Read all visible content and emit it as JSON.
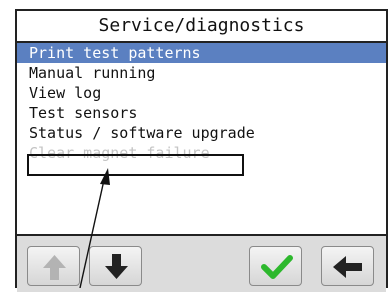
{
  "window": {
    "title": "Service/diagnostics"
  },
  "menu": {
    "items": [
      {
        "label": "Print test patterns",
        "state": "selected"
      },
      {
        "label": "Manual running",
        "state": "normal"
      },
      {
        "label": "View log",
        "state": "normal"
      },
      {
        "label": "Test sensors",
        "state": "normal"
      },
      {
        "label": "Status / software upgrade",
        "state": "normal"
      },
      {
        "label": "Clear magnet failure",
        "state": "disabled"
      }
    ]
  },
  "toolbar": {
    "buttons": [
      {
        "name": "up-button",
        "icon": "arrow-up-icon",
        "enabled": false
      },
      {
        "name": "down-button",
        "icon": "arrow-down-icon",
        "enabled": true
      },
      {
        "name": "confirm-button",
        "icon": "checkmark-icon",
        "enabled": true
      },
      {
        "name": "back-button",
        "icon": "arrow-left-icon",
        "enabled": true
      }
    ]
  },
  "colors": {
    "selection": "#5b80c1",
    "disabled_text": "#c4c4c4",
    "confirm_green": "#2db82d",
    "toolbar_bg": "#dcdcdc"
  }
}
